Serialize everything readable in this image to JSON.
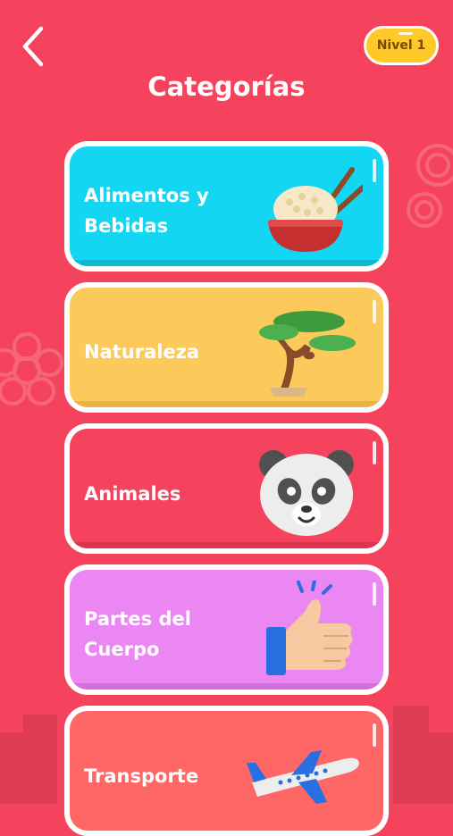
{
  "header": {
    "title": "Categorías",
    "level_label": "Nivel 1"
  },
  "categories": [
    {
      "label": "Alimentos y\nBebidas",
      "icon": "rice-bowl-icon",
      "color": "#13D6F2"
    },
    {
      "label": "Naturaleza",
      "icon": "bonsai-tree-icon",
      "color": "#FCC95B"
    },
    {
      "label": "Animales",
      "icon": "panda-icon",
      "color": "#F5435E"
    },
    {
      "label": "Partes del\nCuerpo",
      "icon": "thumbs-up-icon",
      "color": "#EB87F2"
    },
    {
      "label": "Transporte",
      "icon": "airplane-icon",
      "color": "#FF6767"
    }
  ],
  "colors": {
    "background": "#F5435E",
    "badge": "#FFC928"
  }
}
